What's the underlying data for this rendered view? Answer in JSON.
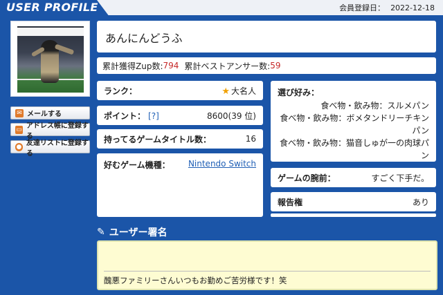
{
  "header": {
    "title": "USER PROFILE",
    "registered_label": "会員登録日：",
    "registered_date": "2022-12-18"
  },
  "sidebar": {
    "buttons": [
      {
        "label": "メールする",
        "icon": "mail-icon"
      },
      {
        "label": "アドレス帳に登録する",
        "icon": "computer-icon"
      },
      {
        "label": "友達リストに登録する",
        "icon": "user-icon"
      }
    ]
  },
  "profile": {
    "name": "あんにんどうふ",
    "zup_label": "累計獲得Zup数:",
    "zup_value": "794",
    "best_answer_label": "累計ベストアンサー数:",
    "best_answer_value": "59"
  },
  "fields": {
    "rank_label": "ランク：",
    "rank_value": "大名人",
    "points_label": "ポイント：",
    "points_help": "[?]",
    "points_value": "8600(39 位)",
    "titles_label": "持ってるゲームタイトル数：",
    "titles_value": "16",
    "platform_label": "好むゲーム機種：",
    "platform_value": "Nintendo Switch",
    "favorites_label": "選び好み：",
    "favorites": [
      "食べ物・飲み物：スルメパン",
      "食べ物・飲み物：ボメタンドリーチキン",
      "パン",
      "食べ物・飲み物：猫音しゅが一の肉球パ",
      "ン"
    ],
    "skill_label": "ゲームの腕前：",
    "skill_value": "すごく下手だ。",
    "report_label": "報告権",
    "report_value": "あり"
  },
  "signature": {
    "title": "ユーザー署名",
    "text": "醜悪ファミリーさんいつもお勤めご苦労様です！笑"
  },
  "colors": {
    "background": "#1b55a8",
    "accent_red": "#c62828",
    "link_blue": "#1f5fb5",
    "signature_bg": "#fefcd2",
    "icon_orange": "#e07a2a"
  }
}
